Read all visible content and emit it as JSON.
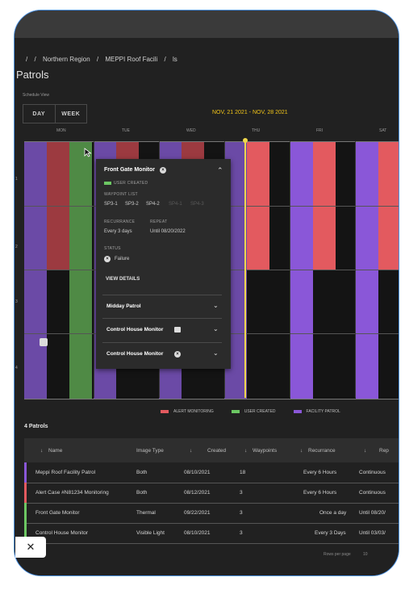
{
  "breadcrumb": {
    "items": [
      "/",
      "/",
      "Northern Region",
      "/",
      "MEPPI Roof Facili",
      "/",
      "ls"
    ]
  },
  "page_title": "Patrols",
  "schedule_view_label": "Schedule View",
  "view_buttons": {
    "day": "DAY",
    "week": "WEEK"
  },
  "date_range": "NOV, 21 2021 - NOV, 28 2021",
  "days": [
    "MON",
    "TUE",
    "WED",
    "THU",
    "FRI",
    "SAT"
  ],
  "row_labels": [
    "1",
    "2",
    "3",
    "4"
  ],
  "colors": {
    "alert": "#e35a5f",
    "user": "#6cc763",
    "facility": "#8a57d8",
    "now": "#f0d84b"
  },
  "popup": {
    "title": "Front Gate Monitor",
    "tag": "USER CREATED",
    "waypoint_list_label": "WAYPOINT LIST",
    "waypoints": [
      "SP3-1",
      "SP3-2",
      "SP4-2",
      "SP4-1",
      "SP4-3"
    ],
    "recurrance_label": "RECURRANCE",
    "recurrance_value": "Every 3 days",
    "repeat_label": "REPEAT",
    "repeat_value": "Until 08/20/2022",
    "status_label": "STATUS",
    "status_value": "Failure",
    "view_details": "VIEW DETAILS",
    "accordions": [
      "Midday Patrol",
      "Control House Monitor",
      "Control House Monitor"
    ]
  },
  "legend": [
    "ALERT MONITORING",
    "USER CREATED",
    "FACILITY PATROL"
  ],
  "count_label": "4 Patrols",
  "table": {
    "headers": [
      "Name",
      "Image Type",
      "Created",
      "Waypoints",
      "Recurrance",
      "Rep"
    ],
    "rows": [
      {
        "name": "Meppi Roof Facility Patrol",
        "image_type": "Both",
        "created": "08/10/2021",
        "waypoints": "18",
        "recurrance": "Every 6 Hours",
        "repeat": "Continuous",
        "type": "facility"
      },
      {
        "name": "Alert Case #N81234 Monitoring",
        "image_type": "Both",
        "created": "08/12/2021",
        "waypoints": "3",
        "recurrance": "Every 6 Hours",
        "repeat": "Continuous",
        "type": "alert"
      },
      {
        "name": "Front Gate Monitor",
        "image_type": "Thermal",
        "created": "09/22/2021",
        "waypoints": "3",
        "recurrance": "Once a day",
        "repeat": "Until 08/20/",
        "type": "user"
      },
      {
        "name": "Control House Monitor",
        "image_type": "Visible Light",
        "created": "08/10/2021",
        "waypoints": "3",
        "recurrance": "Every 3 Days",
        "repeat": "Until 03/03/",
        "type": "user"
      }
    ]
  },
  "footer": {
    "rows_per_page": "Rows per page",
    "value": "10"
  }
}
